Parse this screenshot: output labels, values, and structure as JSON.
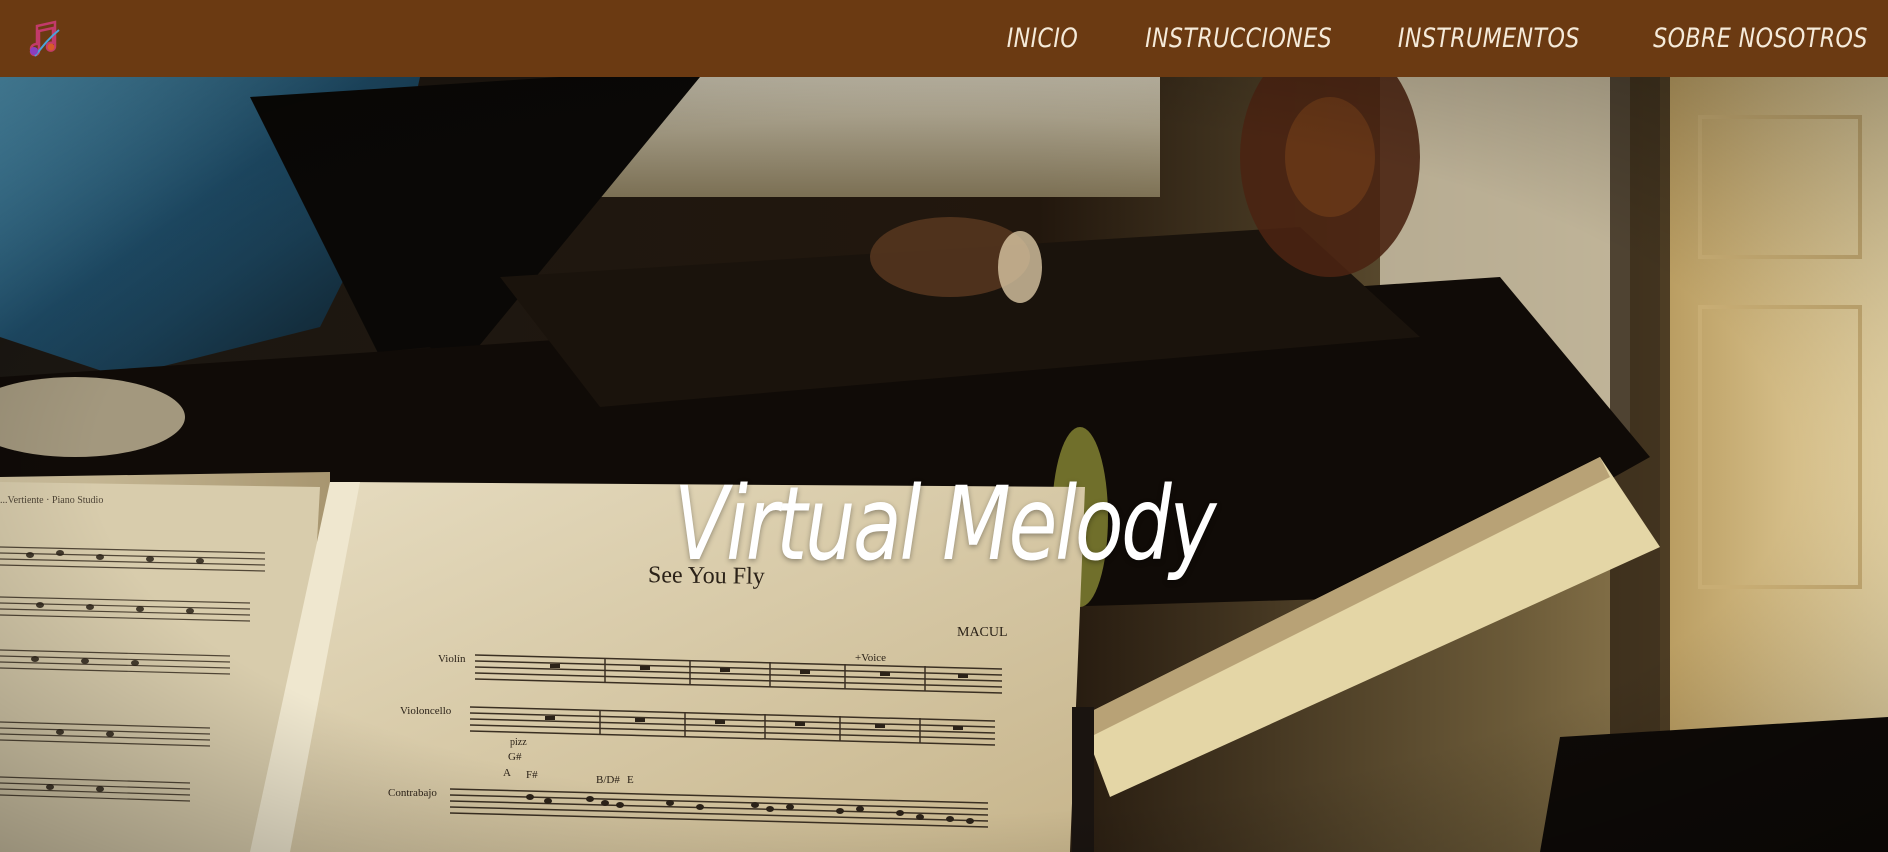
{
  "nav": {
    "logo_icon": "music-note-logo-icon",
    "links": [
      {
        "label": "INICIO"
      },
      {
        "label": "INSTRUCCIONES"
      },
      {
        "label": "INSTRUMENTOS"
      },
      {
        "label": "SOBRE NOSOTROS"
      }
    ]
  },
  "hero": {
    "title": "Virtual Melody",
    "sheet": {
      "song_title": "See You Fly",
      "composer": "MACUL",
      "voice_mark": "+Voice",
      "staves": [
        "Violín",
        "Violoncello",
        "Contrabajo"
      ],
      "chords": [
        "pizz",
        "G#",
        "A",
        "F#",
        "B/D#",
        "E"
      ],
      "left_page_header": "...Vertiente · Piano Studio"
    }
  },
  "colors": {
    "navbar": "#6b3a12",
    "nav_text": "#f5ead9",
    "title": "#ffffff"
  }
}
